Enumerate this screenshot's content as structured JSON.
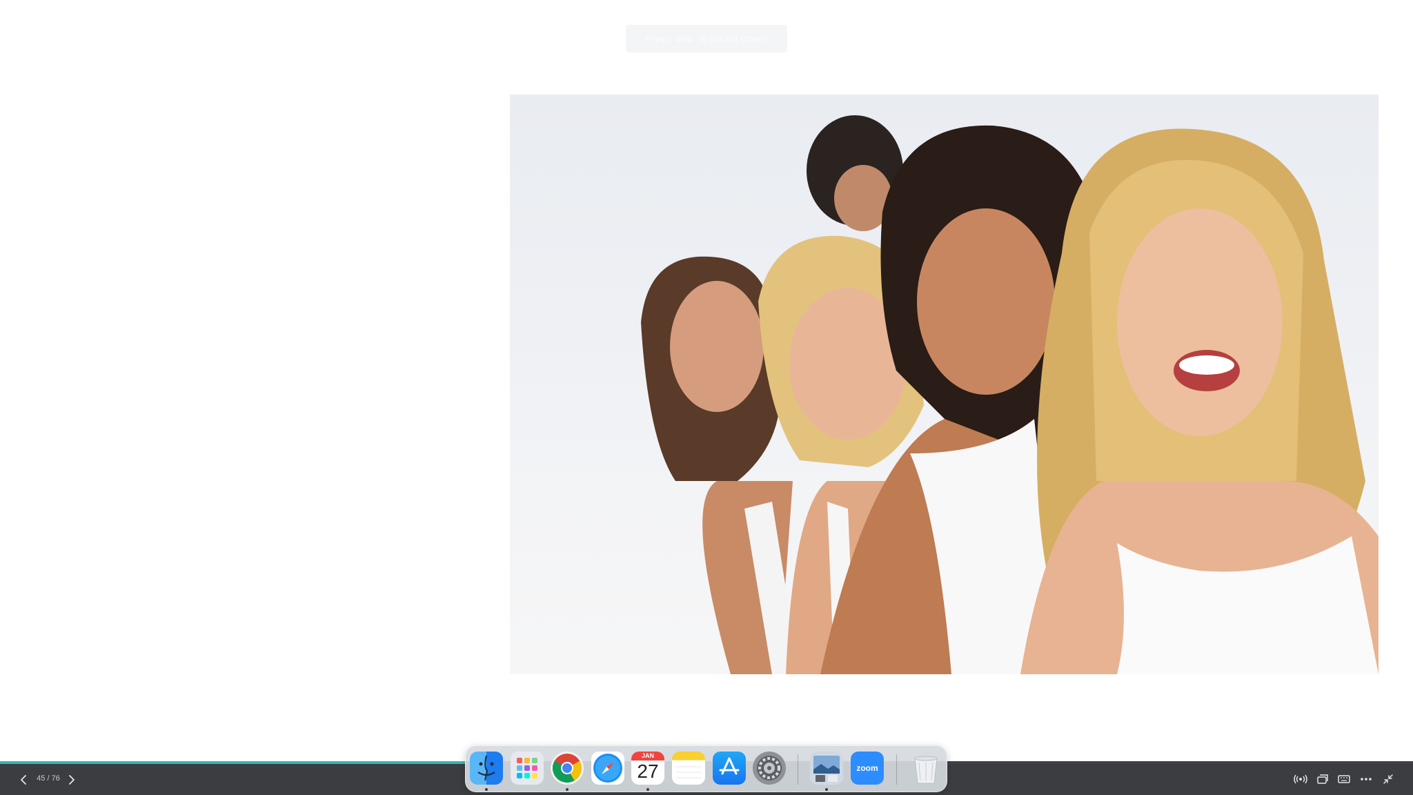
{
  "hint": {
    "text": "Press",
    "key": "esc",
    "suffix": "to exit full screen"
  },
  "slideshow": {
    "counter": "45 / 76",
    "progress": 0.3303
  },
  "photo": {
    "alt_name": "five-women-smiling-photo"
  },
  "dock": {
    "items": [
      {
        "id": "finder",
        "running": true
      },
      {
        "id": "launchpad",
        "running": false
      },
      {
        "id": "chrome",
        "running": true
      },
      {
        "id": "safari",
        "running": false
      },
      {
        "id": "calendar",
        "running": true,
        "month": "JAN",
        "day": "27"
      },
      {
        "id": "notes",
        "running": false
      },
      {
        "id": "app-store",
        "running": false
      },
      {
        "id": "system-settings",
        "running": false
      },
      {
        "id": "preview",
        "running": true
      },
      {
        "id": "zoom",
        "running": false,
        "label": "zoom"
      },
      {
        "id": "trash",
        "running": false
      }
    ]
  },
  "icons": {
    "prev": "chevron-left-icon",
    "next": "chevron-right-icon",
    "broadcast": "broadcast-icon",
    "windows": "windows-icon",
    "keyboard": "keyboard-icon",
    "more": "more-icon",
    "exit_fullscreen": "exit-fullscreen-icon"
  },
  "colors": {
    "progress": "#36b7b3",
    "controlbar": "#3b3d40"
  }
}
